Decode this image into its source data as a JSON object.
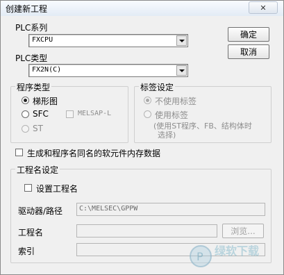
{
  "dialog": {
    "title": "创建新工程",
    "close_glyph": "✕"
  },
  "plc_series": {
    "label": "PLC系列",
    "value": "FXCPU"
  },
  "plc_type": {
    "label": "PLC类型",
    "value": "FX2N(C)"
  },
  "buttons": {
    "ok": "确定",
    "cancel": "取消"
  },
  "program_type": {
    "title": "程序类型",
    "ladder": "梯形图",
    "sfc": "SFC",
    "st": "ST",
    "melsap": "MELSAP-L"
  },
  "label_setting": {
    "title": "标签设定",
    "no_label": "不使用标签",
    "use_label": "使用标签",
    "use_label_note_1": "(使用ST程序、FB、结构体时",
    "use_label_note_2": "选择)"
  },
  "generate_same_name": "生成和程序名同名的软元件内存数据",
  "project_name_setting": {
    "title": "工程名设定",
    "set_project_name": "设置工程名",
    "drive_path_label": "驱动器/路径",
    "drive_path_value": "C:\\MELSEC\\GPPW",
    "project_name_label": "工程名",
    "project_name_value": "",
    "browse": "浏览...",
    "index_label": "索引",
    "index_value": ""
  },
  "watermark": {
    "text": "绿软下载"
  }
}
